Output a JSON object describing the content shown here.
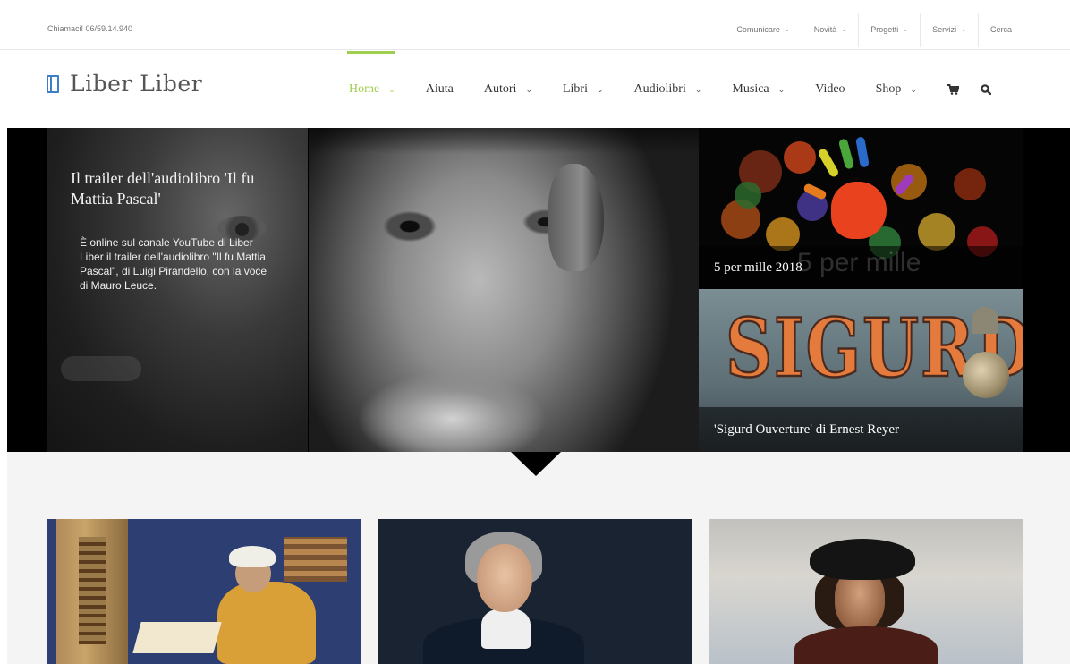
{
  "topbar": {
    "phone": "Chiamaci! 06/59.14.940",
    "menu": [
      {
        "label": "Comunicare",
        "dropdown": true
      },
      {
        "label": "Novità",
        "dropdown": true
      },
      {
        "label": "Progetti",
        "dropdown": true
      },
      {
        "label": "Servizi",
        "dropdown": true
      },
      {
        "label": "Cerca",
        "dropdown": false
      }
    ]
  },
  "header": {
    "logo_text": "Liber Liber",
    "nav": [
      {
        "label": "Home",
        "dropdown": true,
        "active": true
      },
      {
        "label": "Aiuta",
        "dropdown": false
      },
      {
        "label": "Autori",
        "dropdown": true
      },
      {
        "label": "Libri",
        "dropdown": true
      },
      {
        "label": "Audiolibri",
        "dropdown": true
      },
      {
        "label": "Musica",
        "dropdown": true
      },
      {
        "label": "Video",
        "dropdown": false
      },
      {
        "label": "Shop",
        "dropdown": true
      }
    ],
    "icons": [
      "cart-icon",
      "search-icon"
    ]
  },
  "hero": {
    "featured": {
      "title": "Il trailer dell'audiolibro 'Il fu Mattia Pascal'",
      "text": "È online sul canale YouTube di Liber Liber il trailer dell'audiolibro \"Il fu Mattia Pascal\", di Luigi Pirandello, con la voce di Mauro Leuce."
    },
    "side_items": [
      {
        "caption": "5 per mille 2018",
        "ghost": "5 per mille"
      },
      {
        "caption": "'Sigurd Ouverture' di Ernest Reyer",
        "art_text": "SIGURD"
      }
    ]
  },
  "colors": {
    "accent_green": "#a0ce4e",
    "logo_blue": "#3e7ec4",
    "band_grey": "#f4f4f4"
  }
}
